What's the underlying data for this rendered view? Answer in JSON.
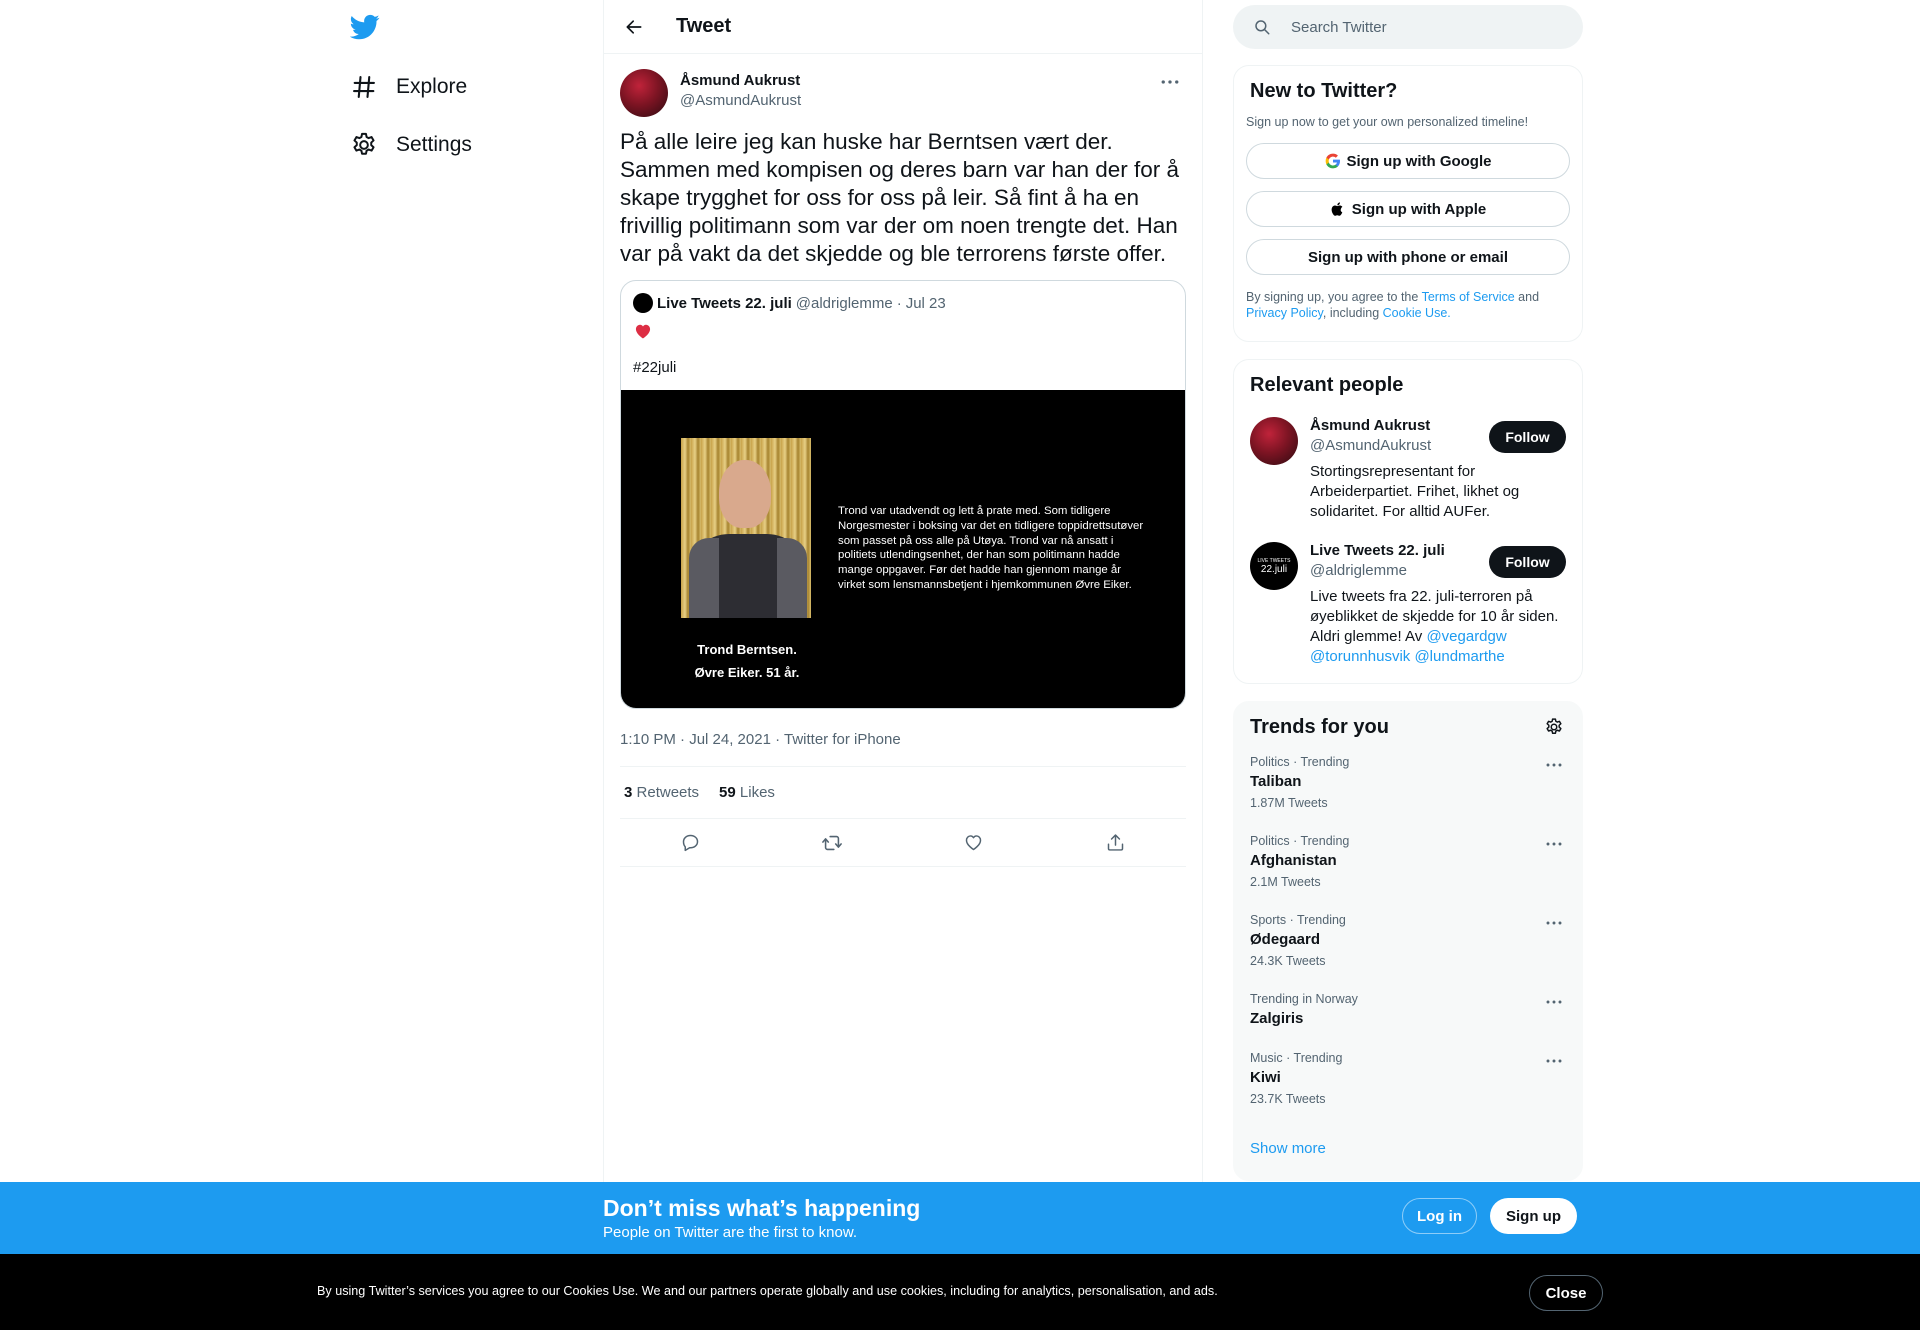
{
  "nav": {
    "logo": "twitter-bird-icon",
    "items": [
      {
        "label": "Explore",
        "icon": "hashtag-icon"
      },
      {
        "label": "Settings",
        "icon": "gear-icon"
      }
    ]
  },
  "header": {
    "title": "Tweet",
    "back_icon": "arrow-left-icon"
  },
  "tweet": {
    "author_name": "Åsmund Aukrust",
    "author_handle": "@AsmundAukrust",
    "text": "På alle leire jeg kan huske har Berntsen vært der. Sammen med kompisen og deres barn var han der for å skape trygghet for oss for oss på leir. Så fint å ha en frivillig politimann som var der om noen trengte det. Han var på vakt da det skjedde og ble terrorens første offer.",
    "quote": {
      "name": "Live Tweets 22. juli",
      "handle": "@aldriglemme",
      "separator": "·",
      "date": "Jul 23",
      "emoji": "red-heart-icon",
      "hashtag": "#22juli",
      "media": {
        "caption_line1": "Trond Berntsen.",
        "caption_line2": "Øvre Eiker. 51 år.",
        "text": "Trond var utadvendt og lett å prate med. Som tidligere Norgesmester i boksing var det en tidligere toppidrettsutøver som passet på oss alle på Utøya. Trond var nå ansatt i politiets utlendingsenhet, der han som politimann hadde mange oppgaver. Før det hadde han gjennom mange år virket som lensmannsbetjent i hjemkommunen Øvre Eiker."
      }
    },
    "timestamp": "1:10 PM · Jul 24, 2021 · Twitter for iPhone",
    "retweets_count": "3",
    "retweets_label": "Retweets",
    "likes_count": "59",
    "likes_label": "Likes",
    "actions": [
      "reply-icon",
      "retweet-icon",
      "like-icon",
      "share-icon"
    ]
  },
  "search": {
    "placeholder": "Search Twitter"
  },
  "new_to_twitter": {
    "title": "New to Twitter?",
    "subtitle": "Sign up now to get your own personalized timeline!",
    "google": "Sign up with Google",
    "apple": "Sign up with Apple",
    "phone": "Sign up with phone or email",
    "legal_prefix": "By signing up, you agree to the",
    "terms": "Terms of Service",
    "and": "and",
    "privacy": "Privacy Policy",
    "including": ", including",
    "cookie": "Cookie Use."
  },
  "relevant_people": {
    "title": "Relevant people",
    "people": [
      {
        "name": "Åsmund Aukrust",
        "handle": "@AsmundAukrust",
        "bio": "Stortingsrepresentant for Arbeiderpartiet. Frihet, likhet og solidaritet. For alltid AUFer.",
        "follow": "Follow"
      },
      {
        "name": "Live Tweets 22. juli",
        "handle": "@aldriglemme",
        "avatar_small": "LIVE TWEETS",
        "avatar_big": "22.juli",
        "bio": "Live tweets fra 22. juli-terroren på øyeblikket de skjedde for 10 år siden. Aldri glemme! Av",
        "mention1": "@vegardgw",
        "mention2": "@torunnhusvik",
        "mention3": "@lundmarthe",
        "follow": "Follow"
      }
    ]
  },
  "trends": {
    "title": "Trends for you",
    "items": [
      {
        "meta": "Politics · Trending",
        "name": "Taliban",
        "count": "1.87M Tweets"
      },
      {
        "meta": "Politics · Trending",
        "name": "Afghanistan",
        "count": "2.1M Tweets"
      },
      {
        "meta": "Sports · Trending",
        "name": "Ødegaard",
        "count": "24.3K Tweets"
      },
      {
        "meta": "Trending in Norway",
        "name": "Zalgiris",
        "count": ""
      },
      {
        "meta": "Music · Trending",
        "name": "Kiwi",
        "count": "23.7K Tweets"
      }
    ],
    "show_more": "Show more"
  },
  "bottom_bar": {
    "title": "Don’t miss what’s happening",
    "subtitle": "People on Twitter are the first to know.",
    "login": "Log in",
    "signup": "Sign up"
  },
  "cookie_bar": {
    "text": "By using Twitter’s services you agree to our Cookies Use. We and our partners operate globally and use cookies, including for analytics, personalisation, and ads.",
    "close": "Close"
  },
  "colors": {
    "accent": "#1d9bf0",
    "text": "#0f1419",
    "secondary": "#536471",
    "heart": "#f91880"
  }
}
